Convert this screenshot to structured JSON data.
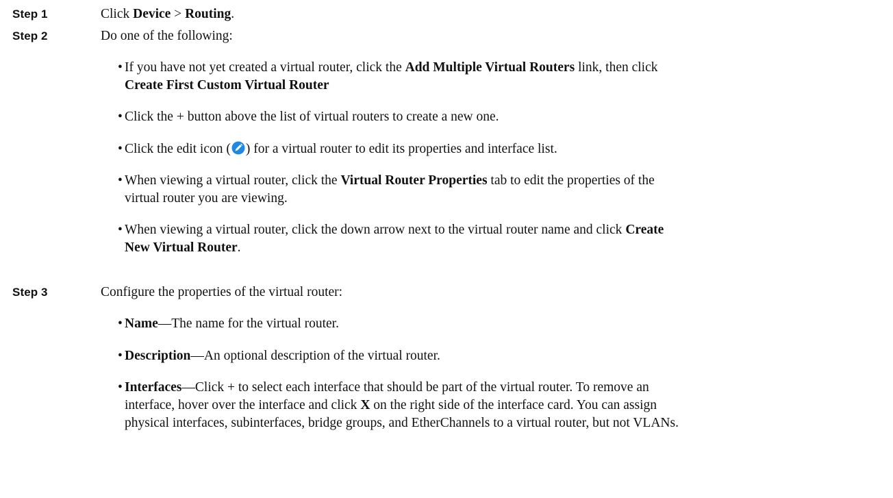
{
  "step1": {
    "label": "Step 1",
    "text_prefix": "Click ",
    "menu_device": "Device",
    "separator": " > ",
    "menu_routing": "Routing",
    "text_suffix": "."
  },
  "step2": {
    "label": "Step 2",
    "text": "Do one of the following:",
    "bullets": {
      "b1": {
        "pre": "If you have not yet created a virtual router, click the ",
        "bold1": "Add Multiple Virtual Routers",
        "mid": " link, then click",
        "bold2": "Create First Custom Virtual Router"
      },
      "b2": {
        "text": "Click the + button above the list of virtual routers to create a new one."
      },
      "b3": {
        "pre": "Click the edit icon (",
        "icon": "edit-icon",
        "post": ") for a virtual router to edit its properties and interface list."
      },
      "b4": {
        "pre": "When viewing a virtual router, click the ",
        "bold": "Virtual Router Properties",
        "post1": " tab to edit the properties of the",
        "post2": "virtual router you are viewing."
      },
      "b5": {
        "pre": "When viewing a virtual router, click the down arrow next to the virtual router name and click ",
        "bold1": "Create",
        "bold2": "New Virtual Router",
        "post": "."
      }
    }
  },
  "step3": {
    "label": "Step 3",
    "text": "Configure the properties of the virtual router:",
    "bullets": {
      "name": {
        "term": "Name",
        "desc": "—The name for the virtual router."
      },
      "description": {
        "term": "Description",
        "desc": "—An optional description of the virtual router."
      },
      "interfaces": {
        "term": "Interfaces",
        "line1": "—Click + to select each interface that should be part of the virtual router. To remove an",
        "line2_pre": "interface, hover over the interface and click ",
        "line2_bold": "X",
        "line2_post": " on the right side of the interface card. You can assign",
        "line3": "physical interfaces, subinterfaces, bridge groups, and EtherChannels to a virtual router, but not VLANs."
      }
    }
  },
  "colors": {
    "edit_icon_fill": "#1e88e5",
    "text": "#111111"
  }
}
